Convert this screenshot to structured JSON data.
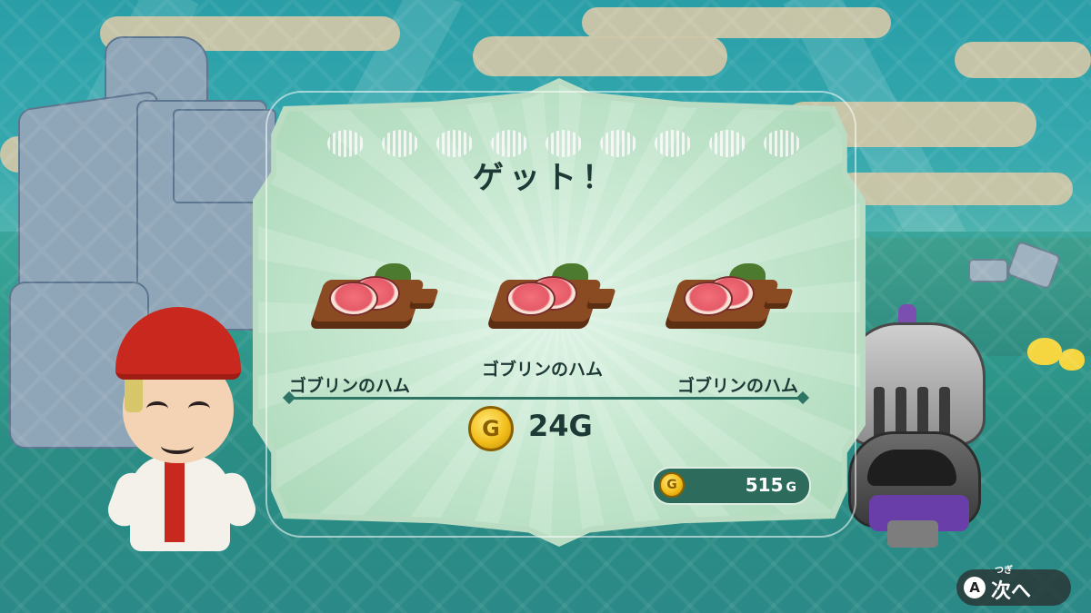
{
  "reward_panel": {
    "title": "ゲット！",
    "items": [
      {
        "name": "ゴブリンのハム",
        "icon": "ham-on-cutting-board-icon"
      },
      {
        "name": "ゴブリンのハム",
        "icon": "ham-on-cutting-board-icon"
      },
      {
        "name": "ゴブリンのハム",
        "icon": "ham-on-cutting-board-icon"
      }
    ],
    "gold_gain": {
      "coin_letter": "G",
      "amount": "24G"
    }
  },
  "wallet": {
    "coin_letter": "G",
    "amount": "515",
    "unit": "G"
  },
  "prompt": {
    "button": "A",
    "label": "次へ",
    "furigana": "つぎ"
  },
  "colors": {
    "panel": "#b9dcc3",
    "panel_text": "#1e3a37",
    "wallet_bg": "#2d6c5c",
    "coin_gold": "#f2bf1c",
    "ham_pink": "#e65a68",
    "board_brown": "#8a4a22"
  }
}
